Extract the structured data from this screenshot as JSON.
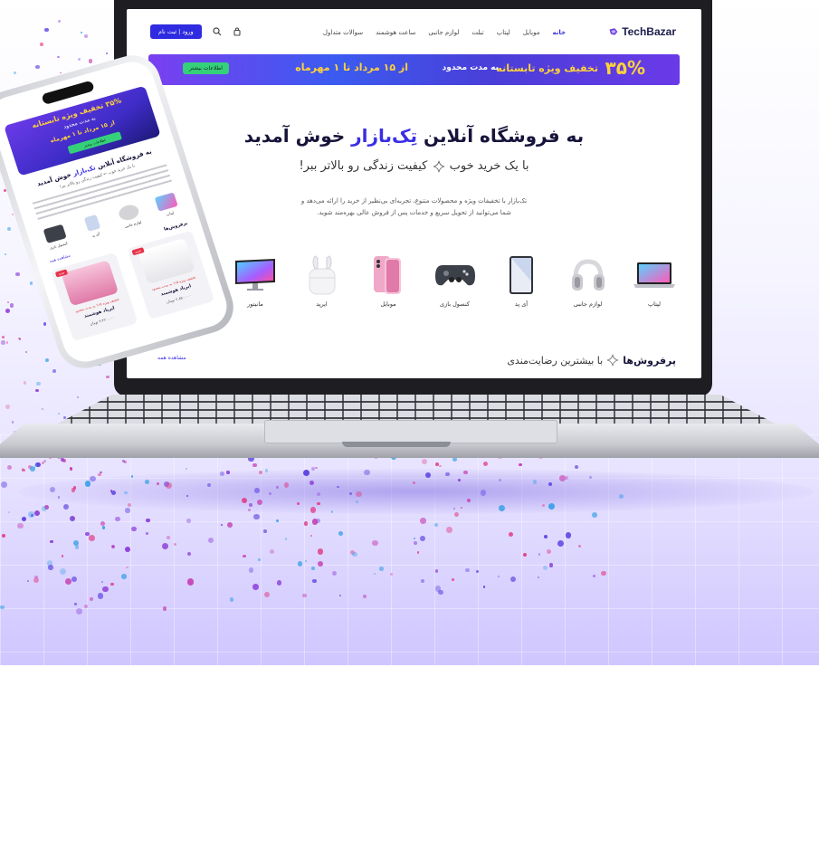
{
  "nav": {
    "brand": "TechBazar",
    "links": [
      {
        "label": "خانه",
        "active": true
      },
      {
        "label": "موبایل",
        "active": false
      },
      {
        "label": "لپتاپ",
        "active": false
      },
      {
        "label": "تبلت",
        "active": false
      },
      {
        "label": "لوازم جانبی",
        "active": false
      },
      {
        "label": "ساعت هوشمند",
        "active": false
      },
      {
        "label": "سوالات متداول",
        "active": false
      }
    ],
    "login_label": "ورود | ثبت نام",
    "search_icon": "search-icon",
    "cart_icon": "cart-icon"
  },
  "banner": {
    "percent": "۳۵%",
    "title": "تخفیف ویژه تابستانه",
    "subtitle": "به مدت محدود",
    "dates": "از ۱۵ مرداد تا ۱ مهرماه",
    "button_label": "اطلاعات بیشتر"
  },
  "hero": {
    "title_prefix": "به فروشگاه آنلاین",
    "title_brand": "تِک‌بازار",
    "title_suffix": "خوش آمدید",
    "subtitle_prefix": "با یک خرید خوب",
    "subtitle_suffix": "کیفیت زندگی رو بالاتر ببر!",
    "description_line1": "تک‌بازار با تخفیفات ویژه و محصولات متنوع، تجربه‌ای بی‌نظیر از خرید را ارائه می‌دهد و",
    "description_line2": "شما می‌توانید از تحویل سریع و خدمات پس از فروش عالی بهره‌مند شوید."
  },
  "categories": [
    {
      "label": "لپتاپ",
      "icon": "laptop-icon"
    },
    {
      "label": "لوازم جانبی",
      "icon": "headphones-icon"
    },
    {
      "label": "آی پد",
      "icon": "ipad-icon"
    },
    {
      "label": "کنسول بازی",
      "icon": "gamepad-icon"
    },
    {
      "label": "موبایل",
      "icon": "phone-icon"
    },
    {
      "label": "ایرپد",
      "icon": "airpods-icon"
    },
    {
      "label": "مانیتور",
      "icon": "monitor-icon"
    }
  ],
  "bestsellers": {
    "title": "پرفروش‌ها",
    "subtitle": "با بیشترین رضایت‌مندی"
  },
  "phone": {
    "banner_line1": "۳۵% تخفیف ویژه تابستانه",
    "banner_line2": "به مدت محدود",
    "banner_line3": "از ۱۵ مرداد تا ۱ مهرماه",
    "banner_button": "اطلاعات بیشتر",
    "title_prefix": "به فروشگاه آنلاین",
    "title_brand": "تک‌بازار",
    "title_suffix": "خوش آمدید",
    "subtitle": "با یک خرید خوب ← کیفیت زندگی رو بالاتر ببر!",
    "categories": [
      "لپتاپ",
      "لوازم جانبی",
      "آی پد",
      "کنسول بازی"
    ],
    "bestsellers_title": "پرفروش‌ها",
    "view_all": "مشاهده همه",
    "cards": [
      {
        "tag": "جدید",
        "note": "تخفیف ویژه ۱۵٪ به مدت محدود",
        "name": "ایرپاد هوشمند",
        "price": "۲.۸۵۰.۰۰۰ تومان"
      },
      {
        "tag": "جدید",
        "note": "تخفیف ویژه ۱۵٪ به مدت محدود",
        "name": "ایرپاد هوشمند",
        "price": "۳.۴۲۰.۰۰۰ تومان"
      }
    ]
  },
  "colors": {
    "accent": "#3a2ee6",
    "banner_yellow": "#ffd23a",
    "banner_green": "#35d07a",
    "heading": "#16143a"
  }
}
